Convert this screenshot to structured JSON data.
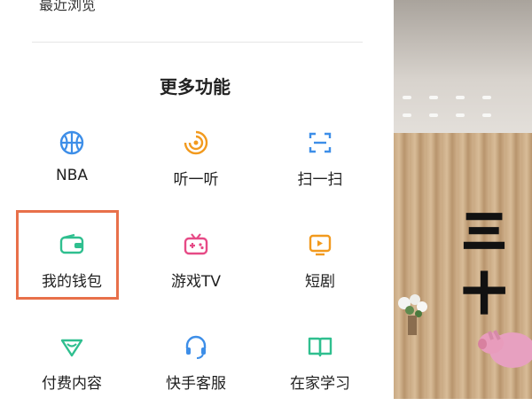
{
  "top_item": {
    "label": "最近浏览"
  },
  "section": {
    "title": "更多功能"
  },
  "items": [
    {
      "label": "NBA",
      "icon": "basketball-icon",
      "color": "#3d8ee8"
    },
    {
      "label": "听一听",
      "icon": "listen-waves-icon",
      "color": "#f29a1e"
    },
    {
      "label": "扫一扫",
      "icon": "scan-icon",
      "color": "#3d8ee8"
    },
    {
      "label": "我的钱包",
      "icon": "wallet-icon",
      "color": "#2fbf8f"
    },
    {
      "label": "游戏TV",
      "icon": "game-tv-icon",
      "color": "#e64a86"
    },
    {
      "label": "短剧",
      "icon": "short-drama-icon",
      "color": "#f29a1e"
    },
    {
      "label": "付费内容",
      "icon": "paid-content-icon",
      "color": "#2fbf8f"
    },
    {
      "label": "快手客服",
      "icon": "headset-icon",
      "color": "#3d8ee8"
    },
    {
      "label": "在家学习",
      "icon": "book-icon",
      "color": "#2fbf8f"
    }
  ],
  "highlight_color": "#e8704a",
  "video": {
    "overlay_text": "三十"
  }
}
